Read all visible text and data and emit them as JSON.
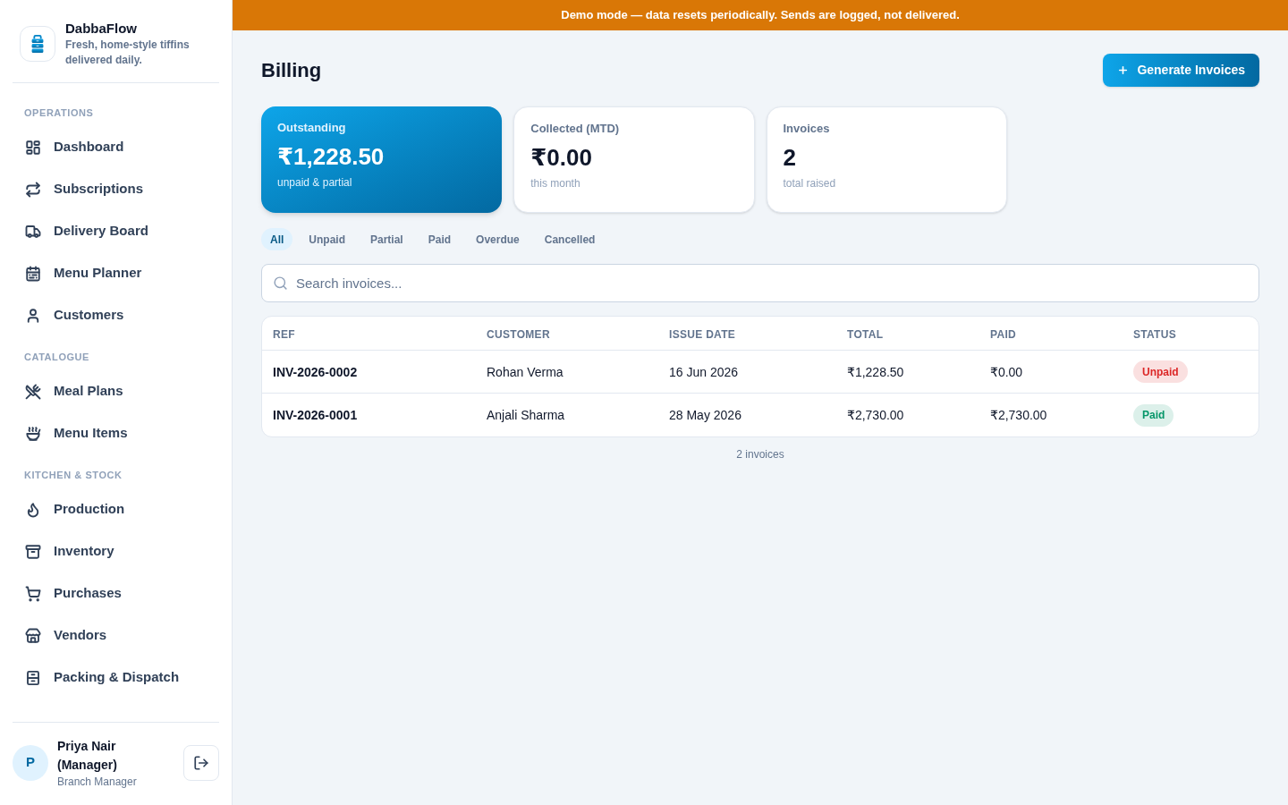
{
  "banner": {
    "text": "Demo mode — data resets periodically. Sends are logged, not delivered."
  },
  "sidebar": {
    "brand": {
      "name": "DabbaFlow",
      "tagline": "Fresh, home-style tiffins delivered daily."
    },
    "sections": [
      {
        "label": "OPERATIONS",
        "items": [
          {
            "label": "Dashboard"
          },
          {
            "label": "Subscriptions"
          },
          {
            "label": "Delivery Board"
          },
          {
            "label": "Menu Planner"
          },
          {
            "label": "Customers"
          }
        ]
      },
      {
        "label": "CATALOGUE",
        "items": [
          {
            "label": "Meal Plans"
          },
          {
            "label": "Menu Items"
          }
        ]
      },
      {
        "label": "KITCHEN & STOCK",
        "items": [
          {
            "label": "Production"
          },
          {
            "label": "Inventory"
          },
          {
            "label": "Purchases"
          },
          {
            "label": "Vendors"
          },
          {
            "label": "Packing & Dispatch"
          }
        ]
      }
    ],
    "user": {
      "initial": "P",
      "name": "Priya Nair (Manager)",
      "role": "Branch Manager"
    }
  },
  "page": {
    "title": "Billing",
    "action": {
      "label": "Generate Invoices"
    }
  },
  "stats": [
    {
      "kind": "accent",
      "label": "Outstanding",
      "value": "₹1,228.50",
      "note": "unpaid & partial"
    },
    {
      "kind": "plain",
      "label": "Collected (MTD)",
      "value": "₹0.00",
      "note": "this month"
    },
    {
      "kind": "plain",
      "label": "Invoices",
      "value": "2",
      "note": "total raised"
    }
  ],
  "filters": [
    {
      "label": "All",
      "selected": true
    },
    {
      "label": "Unpaid",
      "selected": false
    },
    {
      "label": "Partial",
      "selected": false
    },
    {
      "label": "Paid",
      "selected": false
    },
    {
      "label": "Overdue",
      "selected": false
    },
    {
      "label": "Cancelled",
      "selected": false
    }
  ],
  "search": {
    "placeholder": "Search invoices..."
  },
  "table": {
    "columns": [
      "REF",
      "CUSTOMER",
      "ISSUE DATE",
      "TOTAL",
      "PAID",
      "STATUS"
    ],
    "rows": [
      {
        "ref": "INV-2026-0002",
        "customer": "Rohan Verma",
        "issue_date": "16 Jun 2026",
        "total": "₹1,228.50",
        "paid": "₹0.00",
        "status": {
          "label": "Unpaid",
          "color": "#dc2626"
        }
      },
      {
        "ref": "INV-2026-0001",
        "customer": "Anjali Sharma",
        "issue_date": "28 May 2026",
        "total": "₹2,730.00",
        "paid": "₹2,730.00",
        "status": {
          "label": "Paid",
          "color": "#059669"
        }
      }
    ]
  },
  "count": "2 invoices"
}
